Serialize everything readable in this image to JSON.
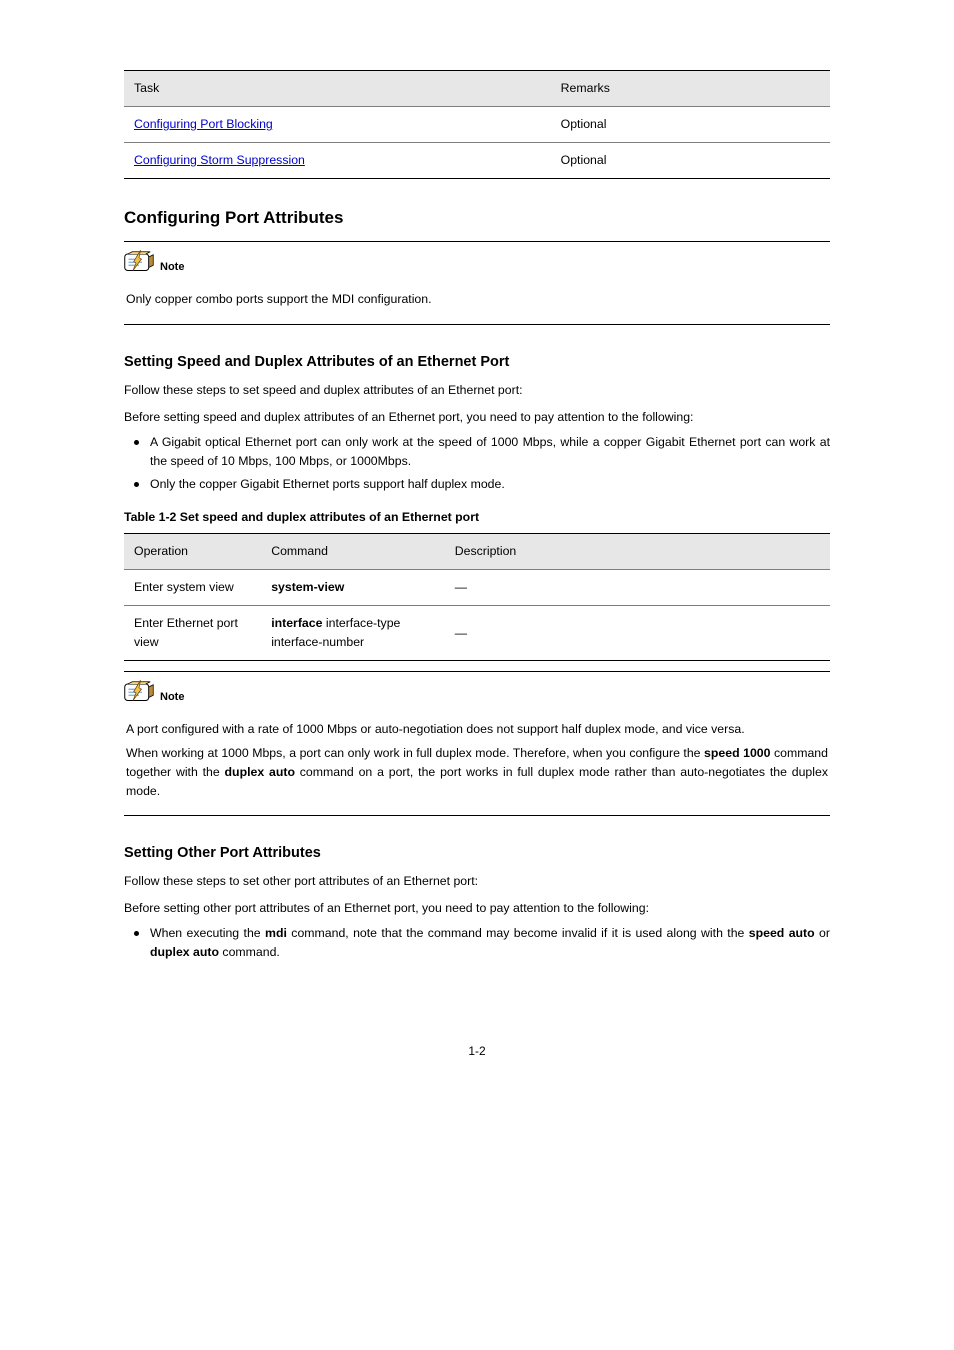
{
  "table1": {
    "header": {
      "task": "Task",
      "remarks": "Remarks"
    },
    "rows": [
      {
        "link": "Configuring Port Blocking",
        "remarks": "Optional"
      },
      {
        "link": "Configuring Storm Suppression",
        "remarks": "Optional"
      }
    ]
  },
  "heading1": "Configuring Port Attributes",
  "note1_text": "Only copper combo ports support the MDI configuration.",
  "heading1_sub": "Setting Speed and Duplex Attributes of an Ethernet Port",
  "para1": "Follow these steps to set speed and duplex attributes of an Ethernet port:",
  "pre_bullets_text": "Before setting speed and duplex attributes of an Ethernet port, you need to pay attention to the following:",
  "bullet1": "A Gigabit optical Ethernet port can only work at the speed of 1000 Mbps, while a copper Gigabit Ethernet port can work at the speed of 10 Mbps, 100 Mbps, or 1000Mbps.",
  "bullet2": "Only the copper Gigabit Ethernet ports support half duplex mode.",
  "table2_caption": "Table 1-2 Set speed and duplex attributes of an Ethernet port",
  "table2": {
    "header": {
      "op": "Operation",
      "cmd": "Command",
      "desc": "Description"
    },
    "rows": [
      {
        "op": "Enter system view",
        "cmd": "system-view",
        "desc": "—"
      },
      {
        "op": "Enter Ethernet port view",
        "cmd_html": "<span class='b'>interface</span> <span>interface-type</span> <span>interface-number</span>",
        "desc": "—"
      }
    ]
  },
  "note2_p1": "A port configured with a rate of 1000 Mbps or auto-negotiation does not support half duplex mode, and vice versa.",
  "note2_p2_html": "When working at 1000 Mbps, a port can only work in full duplex mode. Therefore, when you configure the <span class='b'>speed 1000</span> command together with the <span class='b'>duplex auto</span> command on a port, the port works in full duplex mode rather than auto-negotiates the duplex mode.",
  "heading2_sub": "Setting Other Port Attributes",
  "para2": "Follow these steps to set other port attributes of an Ethernet port:",
  "pre_bullets2_text": "Before setting other port attributes of an Ethernet port, you need to pay attention to the following:",
  "bullet3_html": "When executing the <span class='b'>mdi</span> command, note that the command may become invalid if it is used along with the <span class='b'>speed auto</span> or <span class='b'>duplex auto</span> command.",
  "page_number": "1-2"
}
